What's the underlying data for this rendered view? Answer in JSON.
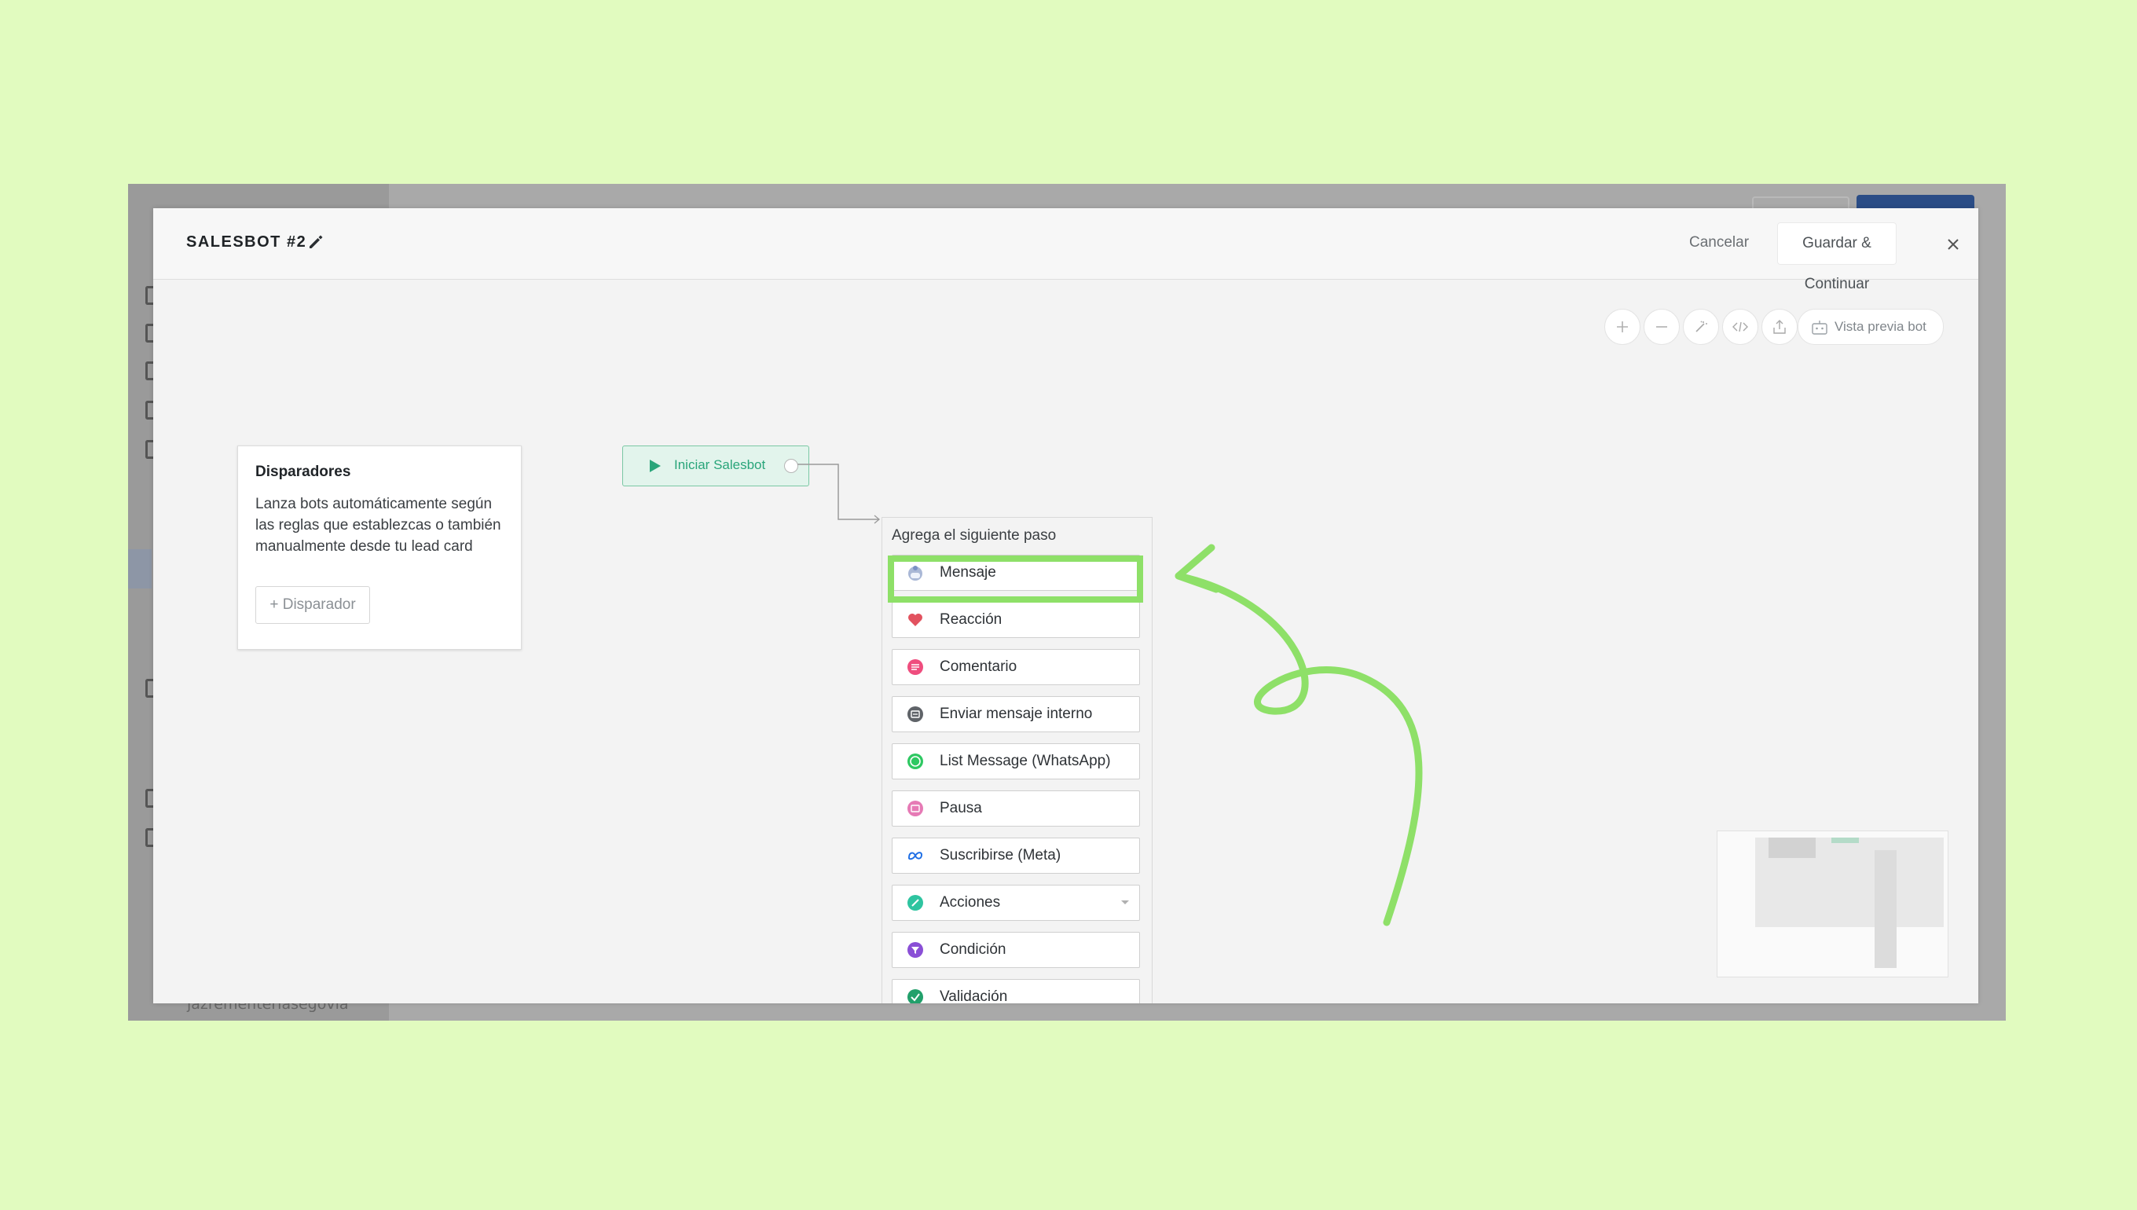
{
  "background_app": {
    "user_name": "jazrementeriasegovia"
  },
  "modal": {
    "title": "SALESBOT #2",
    "cancel_label": "Cancelar",
    "save_label": "Guardar & Continuar"
  },
  "toolbar": {
    "preview_label": "Vista previa bot"
  },
  "triggers": {
    "title": "Disparadores",
    "description": "Lanza bots automáticamente según las reglas que establezcas o también manualmente desde tu lead card",
    "add_label": "+ Disparador"
  },
  "start_node": {
    "label": "Iniciar Salesbot"
  },
  "steps": {
    "title": "Agrega el siguiente paso",
    "items": [
      {
        "label": "Mensaje",
        "icon": "robot-icon"
      },
      {
        "label": "Reacción",
        "icon": "heart-icon"
      },
      {
        "label": "Comentario",
        "icon": "comment-icon"
      },
      {
        "label": "Enviar mensaje interno",
        "icon": "internal-message-icon"
      },
      {
        "label": "List Message (WhatsApp)",
        "icon": "whatsapp-icon"
      },
      {
        "label": "Pausa",
        "icon": "pause-icon"
      },
      {
        "label": "Suscribirse (Meta)",
        "icon": "meta-icon"
      },
      {
        "label": "Acciones",
        "icon": "actions-icon"
      },
      {
        "label": "Condición",
        "icon": "filter-icon"
      },
      {
        "label": "Validación",
        "icon": "check-icon"
      }
    ]
  },
  "colors": {
    "page_background": "#e1fbbf",
    "highlight": "#8ee068",
    "start_green": "#29a57a"
  }
}
